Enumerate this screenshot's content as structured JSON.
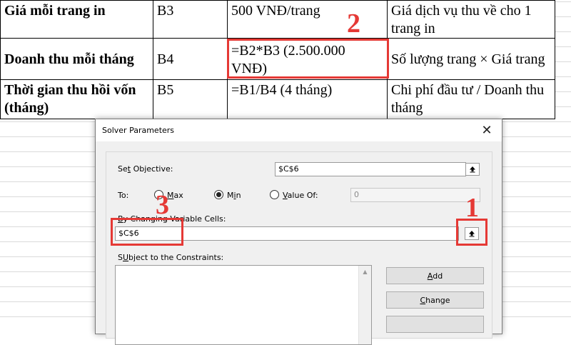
{
  "table": {
    "rows": [
      {
        "label": "Giá mỗi trang in",
        "cell": "B3",
        "value": "500 VNĐ/trang",
        "note": "Giá dịch vụ thu về cho 1 trang in"
      },
      {
        "label": "Doanh thu mỗi tháng",
        "cell": "B4",
        "value": "=B2*B3 (2.500.000 VNĐ)",
        "note": "Số lượng trang × Giá trang"
      },
      {
        "label": "Thời gian thu hồi vốn (tháng)",
        "cell": "B5",
        "value": "=B1/B4 (4 tháng)",
        "note": "Chi phí đầu tư / Doanh thu tháng"
      }
    ]
  },
  "annotations": {
    "n1": "1",
    "n2": "2",
    "n3": "3"
  },
  "dialog": {
    "title": "Solver Parameters",
    "close_glyph": "✕",
    "set_objective": {
      "pre": "Se",
      "key": "t",
      "post": " Objective:",
      "value": "$C$6"
    },
    "to_label": "To:",
    "max": {
      "key": "M",
      "rest": "ax"
    },
    "min": {
      "pre": "M",
      "key": "i",
      "post": "n"
    },
    "value_of": {
      "key": "V",
      "rest": "alue Of:",
      "value": "0"
    },
    "changing": {
      "key": "B",
      "rest": "y Changing Variable Cells:",
      "value": "$C$6"
    },
    "constraints": {
      "key": "U",
      "pre": "S",
      "rest": "bject to the Constraints:"
    },
    "add_button": {
      "key": "A",
      "rest": "dd"
    },
    "change_button": {
      "key": "C",
      "rest": "hange"
    }
  },
  "colors": {
    "annotation": "#e53935"
  }
}
